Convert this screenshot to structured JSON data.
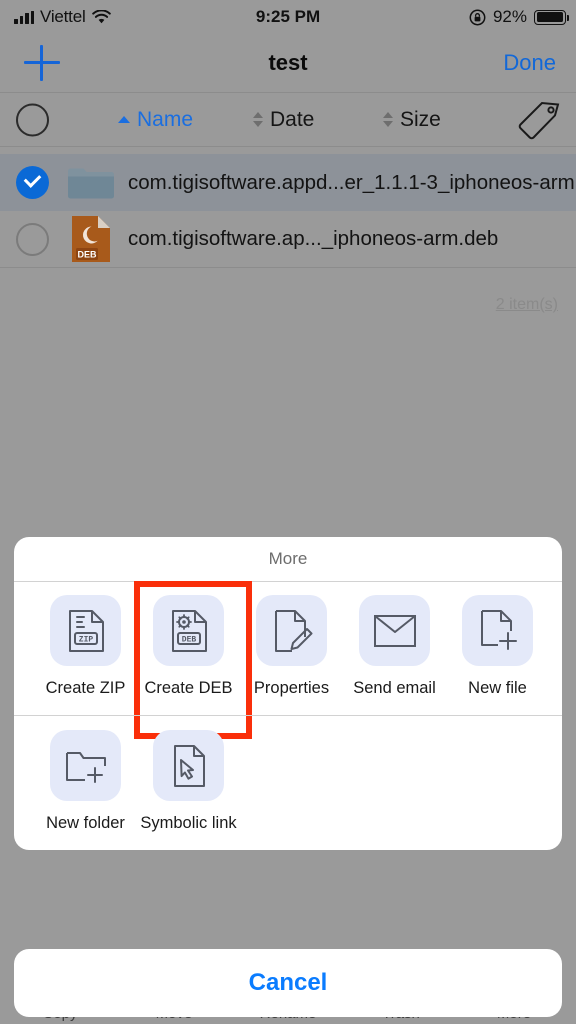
{
  "status_bar": {
    "carrier": "Viettel",
    "signal_icon": "cellular-bars-icon",
    "wifi_icon": "wifi-icon",
    "time": "9:25 PM",
    "rotation_lock_icon": "rotation-lock-icon",
    "battery_percent": "92%",
    "battery_icon": "battery-full-icon"
  },
  "nav_bar": {
    "add_icon": "plus-icon",
    "title": "test",
    "done_label": "Done"
  },
  "sort_bar": {
    "select_all_icon": "circle-unselected-icon",
    "columns": [
      {
        "label": "Name",
        "icon": "chevron-up-icon",
        "active": true
      },
      {
        "label": "Date",
        "icon": "chevron-updown-icon",
        "active": false
      },
      {
        "label": "Size",
        "icon": "chevron-updown-icon",
        "active": false
      }
    ],
    "tag_icon": "tag-icon"
  },
  "file_list": {
    "rows": [
      {
        "name": "com.tigisoftware.appd...er_1.1.1-3_iphoneos-arm",
        "icon": "folder-icon",
        "selected": true
      },
      {
        "name": "com.tigisoftware.ap..._iphoneos-arm.deb",
        "icon": "deb-file-icon",
        "icon_label": "DEB",
        "selected": false
      }
    ],
    "item_count": "2 item(s)"
  },
  "bottom_toolbar": {
    "items": [
      "Copy",
      "Move",
      "Rename",
      "Trash",
      "More"
    ]
  },
  "action_sheet": {
    "title": "More",
    "row1": [
      {
        "label": "Create ZIP",
        "icon": "zip-file-icon",
        "highlighted": false
      },
      {
        "label": "Create DEB",
        "icon": "deb-create-icon",
        "highlighted": true
      },
      {
        "label": "Properties",
        "icon": "file-edit-icon",
        "highlighted": false
      },
      {
        "label": "Send email",
        "icon": "envelope-icon",
        "highlighted": false
      },
      {
        "label": "New file",
        "icon": "file-plus-icon",
        "highlighted": false
      }
    ],
    "row2": [
      {
        "label": "New folder",
        "icon": "folder-plus-icon",
        "highlighted": false
      },
      {
        "label": "Symbolic link",
        "icon": "symlink-icon",
        "highlighted": false
      }
    ],
    "cancel_label": "Cancel",
    "highlight_color": "#fa2f0a"
  }
}
